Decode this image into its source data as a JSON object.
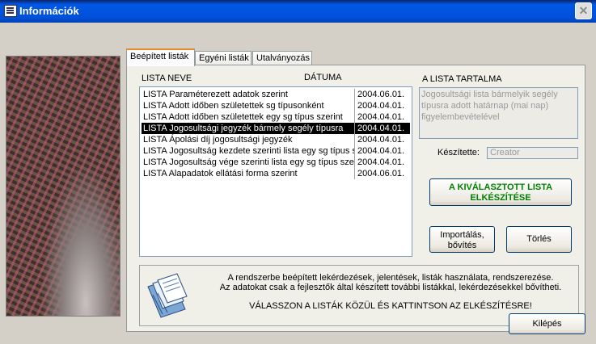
{
  "window": {
    "title": "Információk",
    "close_symbol": "✕"
  },
  "tabs": [
    {
      "label": "Beépített listák"
    },
    {
      "label": "Egyéni listák"
    },
    {
      "label": "Utalványozás"
    }
  ],
  "list": {
    "headers": {
      "name": "LISTA NEVE",
      "date": "DÁTUMA"
    },
    "rows": [
      {
        "name": "LISTA Paraméterezett adatok szerint",
        "date": "2004.06.01."
      },
      {
        "name": "LISTA Adott időben születettek sg típusonként",
        "date": "2004.04.01."
      },
      {
        "name": "LISTA Adott időben születettek egy sg típus szerint",
        "date": "2004.04.01."
      },
      {
        "name": "LISTA Jogosultsági jegyzék bármely segély típusra",
        "date": "2004.04.01."
      },
      {
        "name": "LISTA Ápolási díj jogosultsági jegyzék",
        "date": "2004.04.01."
      },
      {
        "name": "LISTA Jogosultság kezdete szerinti lista egy sg típus szerint",
        "date": "2004.04.01."
      },
      {
        "name": "LISTA Jogosultság vége szerinti lista egy sg típus szerint",
        "date": "2004.04.01."
      },
      {
        "name": "LISTA Alapadatok ellátási forma szerint",
        "date": "2004.06.01."
      }
    ],
    "selected_index": 3
  },
  "content": {
    "label": "A LISTA TARTALMA",
    "text": "Jogosultsági lista bármelyik segély típusra adott határnap (mai nap) figyelembevételével"
  },
  "author": {
    "label": "Készítette:",
    "value": "Creator"
  },
  "buttons": {
    "create_line1": "A KIVÁLASZTOTT LISTA",
    "create_line2": "ELKÉSZÍTÉSE",
    "import_line1": "Importálás,",
    "import_line2": "bővítés",
    "delete": "Törlés",
    "exit": "Kilépés"
  },
  "info": {
    "line1": "A rendszerbe beépített lekérdezések, jelentések, listák használata, rendszerezése.",
    "line2": "Az adatokat csak a fejlesztők által készített további listákkal, lekérdezésekkel bővítheti.",
    "line3": "VÁLASSZON A LISTÁK KÖZÜL ÉS KATTINTSON AZ ELKÉSZÍTÉSRE!"
  },
  "colors": {
    "selection_bg": "#000000",
    "create_button_text": "#008000",
    "titlebar": "#0058e6"
  }
}
